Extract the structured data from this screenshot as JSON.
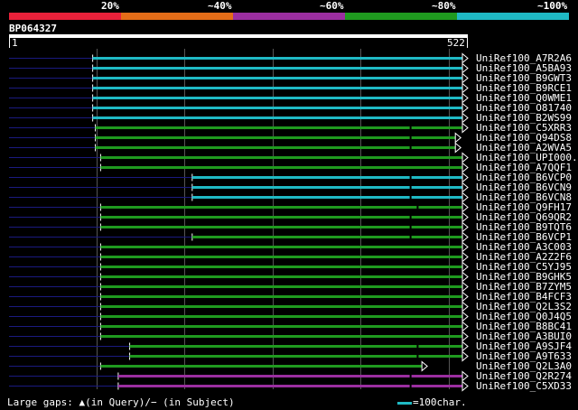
{
  "legend": {
    "items": [
      {
        "label": "20%",
        "color": "#e8213a"
      },
      {
        "label": "~40%",
        "color": "#e46d18"
      },
      {
        "label": "~60%",
        "color": "#9b2ea0"
      },
      {
        "label": "~80%",
        "color": "#1f9a1f"
      },
      {
        "label": "~100%",
        "color": "#1fb9c4"
      }
    ]
  },
  "query": {
    "name": "BP064327",
    "start_label": "1",
    "end_label": "522",
    "length": 522
  },
  "colors": {
    "gap": "#1a1a80",
    "grid": "#555555",
    "query": "#ffffff"
  },
  "hits": [
    {
      "label": "UniRef100_A7R2A6",
      "start": 96,
      "end": 522,
      "color": "#1fb9c4",
      "marks": []
    },
    {
      "label": "UniRef100_A5BA93",
      "start": 96,
      "end": 522,
      "color": "#1fb9c4",
      "marks": []
    },
    {
      "label": "UniRef100_B9GWT3",
      "start": 96,
      "end": 522,
      "color": "#1fb9c4",
      "marks": []
    },
    {
      "label": "UniRef100_B9RCE1",
      "start": 96,
      "end": 522,
      "color": "#1fb9c4",
      "marks": []
    },
    {
      "label": "UniRef100_Q0WME1",
      "start": 96,
      "end": 522,
      "color": "#1fb9c4",
      "marks": []
    },
    {
      "label": "UniRef100_O81740",
      "start": 96,
      "end": 522,
      "color": "#1fb9c4",
      "marks": []
    },
    {
      "label": "UniRef100_B2WS99",
      "start": 96,
      "end": 522,
      "color": "#1fb9c4",
      "marks": []
    },
    {
      "label": "UniRef100_C5XRR3",
      "start": 99,
      "end": 522,
      "color": "#1f9a1f",
      "marks": [
        457
      ]
    },
    {
      "label": "UniRef100_Q94DS8",
      "start": 99,
      "end": 514,
      "color": "#1f9a1f",
      "marks": [
        457
      ]
    },
    {
      "label": "UniRef100_A2WVA5",
      "start": 99,
      "end": 514,
      "color": "#1f9a1f",
      "marks": [
        457
      ]
    },
    {
      "label": "UniRef100_UPI000..",
      "start": 105,
      "end": 522,
      "color": "#1f9a1f",
      "marks": []
    },
    {
      "label": "UniRef100_A7QQF1",
      "start": 105,
      "end": 522,
      "color": "#1f9a1f",
      "marks": []
    },
    {
      "label": "UniRef100_B6VCP0",
      "start": 209,
      "end": 522,
      "color": "#1fb9c4",
      "marks": [
        457
      ]
    },
    {
      "label": "UniRef100_B6VCN9",
      "start": 209,
      "end": 522,
      "color": "#1fb9c4",
      "marks": [
        457
      ]
    },
    {
      "label": "UniRef100_B6VCN8",
      "start": 209,
      "end": 522,
      "color": "#1fb9c4",
      "marks": [
        457
      ]
    },
    {
      "label": "UniRef100_Q9FH17",
      "start": 105,
      "end": 522,
      "color": "#1f9a1f",
      "marks": [
        465
      ]
    },
    {
      "label": "UniRef100_Q69QR2",
      "start": 105,
      "end": 522,
      "color": "#1f9a1f",
      "marks": [
        457
      ]
    },
    {
      "label": "UniRef100_B9TQT6",
      "start": 105,
      "end": 522,
      "color": "#1f9a1f",
      "marks": [
        457
      ]
    },
    {
      "label": "UniRef100_B6VCP1",
      "start": 209,
      "end": 522,
      "color": "#1f9a1f",
      "marks": [
        457
      ]
    },
    {
      "label": "UniRef100_A3C003",
      "start": 105,
      "end": 522,
      "color": "#1f9a1f",
      "marks": []
    },
    {
      "label": "UniRef100_A2Z2F6",
      "start": 105,
      "end": 522,
      "color": "#1f9a1f",
      "marks": []
    },
    {
      "label": "UniRef100_C5YJ95",
      "start": 105,
      "end": 522,
      "color": "#1f9a1f",
      "marks": []
    },
    {
      "label": "UniRef100_B9GHK5",
      "start": 105,
      "end": 522,
      "color": "#1f9a1f",
      "marks": []
    },
    {
      "label": "UniRef100_B7ZYM5",
      "start": 105,
      "end": 522,
      "color": "#1f9a1f",
      "marks": []
    },
    {
      "label": "UniRef100_B4FCF3",
      "start": 105,
      "end": 522,
      "color": "#1f9a1f",
      "marks": []
    },
    {
      "label": "UniRef100_Q2L3S2",
      "start": 105,
      "end": 522,
      "color": "#1f9a1f",
      "marks": []
    },
    {
      "label": "UniRef100_Q0J4Q5",
      "start": 105,
      "end": 522,
      "color": "#1f9a1f",
      "marks": []
    },
    {
      "label": "UniRef100_B8BC41",
      "start": 105,
      "end": 522,
      "color": "#1f9a1f",
      "marks": []
    },
    {
      "label": "UniRef100_A3BUI0",
      "start": 105,
      "end": 522,
      "color": "#1f9a1f",
      "marks": []
    },
    {
      "label": "UniRef100_A9SJF4",
      "start": 138,
      "end": 522,
      "color": "#1f9a1f",
      "marks": [
        465
      ]
    },
    {
      "label": "UniRef100_A9T633",
      "start": 138,
      "end": 522,
      "color": "#1f9a1f",
      "marks": [
        465
      ]
    },
    {
      "label": "UniRef100_Q2L3A0",
      "start": 105,
      "end": 476,
      "color": "#1f9a1f",
      "marks": []
    },
    {
      "label": "UniRef100_Q2R274",
      "start": 125,
      "end": 522,
      "color": "#9b2ea0",
      "marks": [
        457
      ]
    },
    {
      "label": "UniRef100_C5XD33",
      "start": 125,
      "end": 522,
      "color": "#9b2ea0",
      "marks": [
        457
      ]
    }
  ],
  "footer": {
    "gaps_text": "Large gaps: ▲(in Query)/− (in Subject)",
    "scale_text": "=100char.",
    "scale_color": "#1fb9c4"
  }
}
